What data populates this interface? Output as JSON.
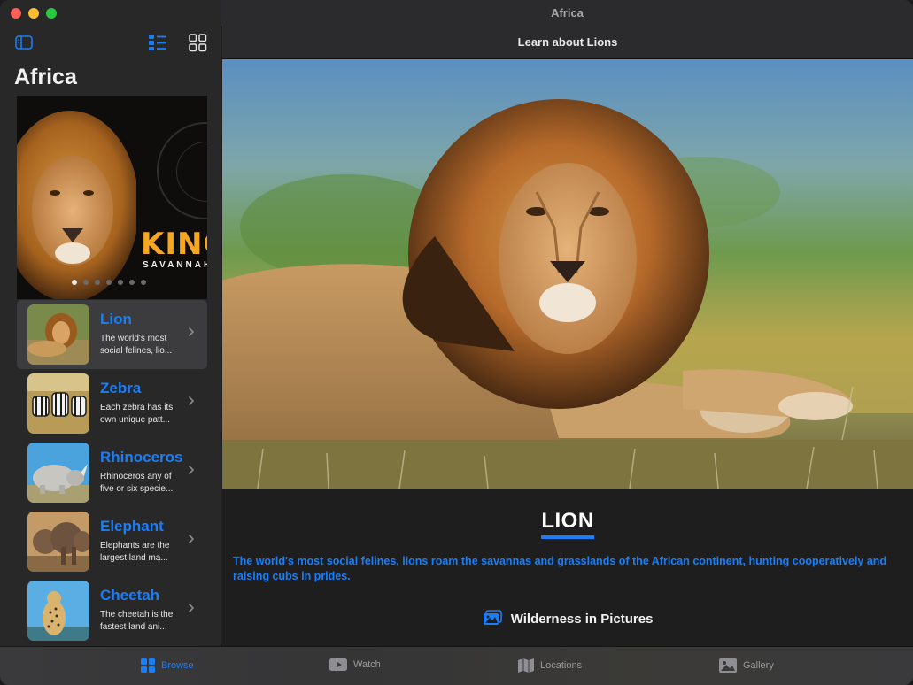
{
  "window": {
    "title": "Africa"
  },
  "sidebar": {
    "title": "Africa",
    "carousel": {
      "title": "KING",
      "subtitle": "SAVANNAH",
      "page_count": 7,
      "active_page": 1
    },
    "items": [
      {
        "name": "Lion",
        "description": "The world's most social felines, lio...",
        "selected": true
      },
      {
        "name": "Zebra",
        "description": "Each zebra has its own unique patt..."
      },
      {
        "name": "Rhinoceros",
        "description": "Rhinoceros any of five or six specie..."
      },
      {
        "name": "Elephant",
        "description": "Elephants are the largest land ma..."
      },
      {
        "name": "Cheetah",
        "description": "The cheetah is the fastest land ani..."
      }
    ]
  },
  "main": {
    "toolbar_title": "Learn about Lions",
    "heading": "LION",
    "description": "The world's most social felines, lions roam the savannas and grasslands of the African continent, hunting cooperatively and raising cubs in prides.",
    "section_title": "Wilderness in Pictures"
  },
  "tabs": [
    {
      "label": "Browse",
      "icon": "browse-icon",
      "active": true
    },
    {
      "label": "Watch",
      "icon": "play-icon"
    },
    {
      "label": "Locations",
      "icon": "map-icon"
    },
    {
      "label": "Gallery",
      "icon": "photo-icon"
    }
  ],
  "colors": {
    "accent": "#1b7ef5",
    "carousel_title": "#f5a623"
  }
}
